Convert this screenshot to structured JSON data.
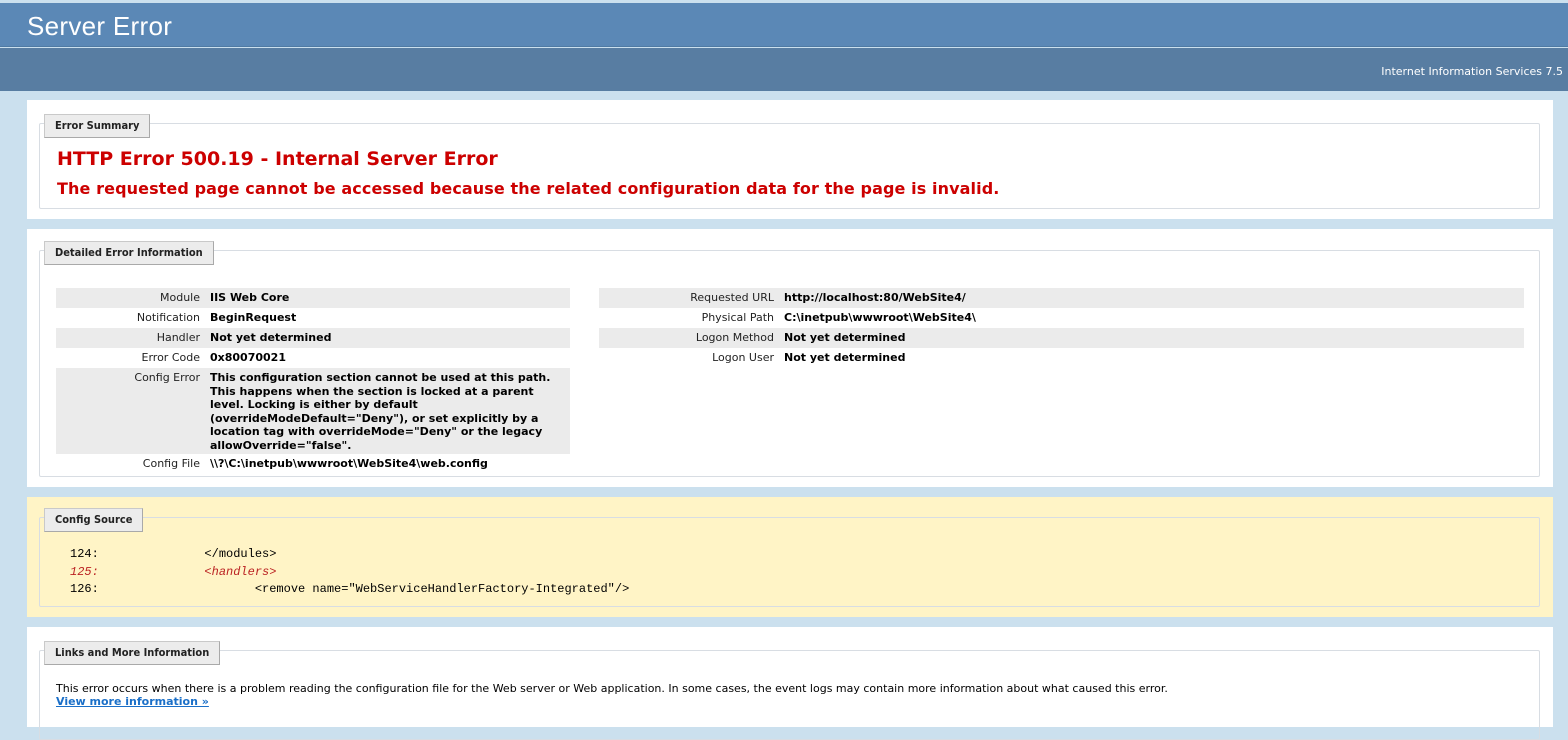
{
  "header": {
    "title": "Server Error",
    "product": "Internet Information Services 7.5"
  },
  "summary": {
    "legend": "Error Summary",
    "title": "HTTP Error 500.19 - Internal Server Error",
    "message": "The requested page cannot be accessed because the related configuration data for the page is invalid."
  },
  "details": {
    "legend": "Detailed Error Information",
    "left": [
      {
        "label": "Module",
        "value": "IIS Web Core"
      },
      {
        "label": "Notification",
        "value": "BeginRequest"
      },
      {
        "label": "Handler",
        "value": "Not yet determined"
      },
      {
        "label": "Error Code",
        "value": "0x80070021"
      },
      {
        "label": "Config Error",
        "value": "This configuration section cannot be used at this path. This happens when the section is locked at a parent level. Locking is either by default (overrideModeDefault=\"Deny\"), or set explicitly by a location tag with overrideMode=\"Deny\" or the legacy allowOverride=\"false\"."
      },
      {
        "label": "Config File",
        "value": "\\\\?\\C:\\inetpub\\wwwroot\\WebSite4\\web.config"
      }
    ],
    "right": [
      {
        "label": "Requested URL",
        "value": "http://localhost:80/WebSite4/"
      },
      {
        "label": "Physical Path",
        "value": "C:\\inetpub\\wwwroot\\WebSite4\\"
      },
      {
        "label": "Logon Method",
        "value": "Not yet determined"
      },
      {
        "label": "Logon User",
        "value": "Not yet determined"
      }
    ]
  },
  "source": {
    "legend": "Config Source",
    "lines": [
      {
        "num": "124:",
        "code": "            </modules>"
      },
      {
        "num": "125:",
        "code": "            <handlers>"
      },
      {
        "num": "126:",
        "code": "                   <remove name=\"WebServiceHandlerFactory-Integrated\"/>"
      }
    ]
  },
  "links": {
    "legend": "Links and More Information",
    "text": "This error occurs when there is a problem reading the configuration file for the Web server or Web application. In some cases, the event logs may contain more information about what caused this error.",
    "link": "View more information »"
  }
}
